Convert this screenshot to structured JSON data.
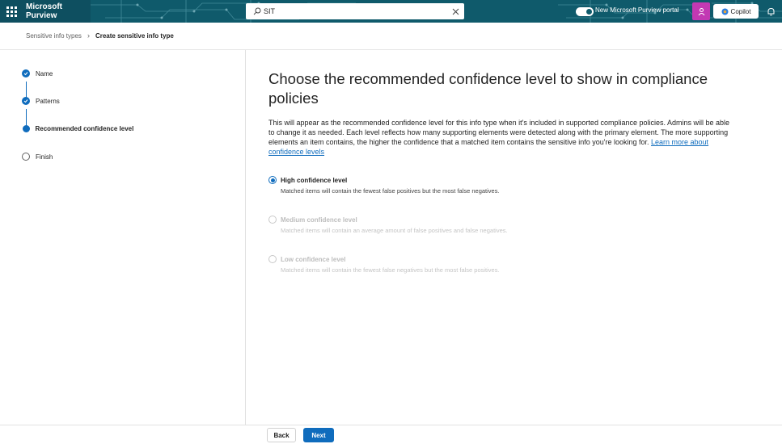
{
  "topbar": {
    "brand": "Microsoft Purview",
    "search_value": "SIT",
    "toggle_label": "New Microsoft Purview portal",
    "copilot_label": "Copilot",
    "colors": {
      "bar": "#0f5a6b",
      "accent_button": "#c239b3"
    }
  },
  "breadcrumb": {
    "items": [
      "Sensitive info types",
      "Create sensitive info type"
    ]
  },
  "wizard": {
    "steps": [
      {
        "label": "Name",
        "state": "done"
      },
      {
        "label": "Patterns",
        "state": "done"
      },
      {
        "label": "Recommended confidence level",
        "state": "current"
      },
      {
        "label": "Finish",
        "state": "pending"
      }
    ]
  },
  "main": {
    "title": "Choose the recommended confidence level to show in compliance policies",
    "description": "This will appear as the recommended confidence level for this info type when it's included in supported compliance policies. Admins will be able to change it as needed. Each level reflects how many supporting elements were detected along with the primary element. The more supporting elements an item contains, the higher the confidence that a matched item contains the sensitive info you're looking for.",
    "learn_more": "Learn more about confidence levels",
    "options": [
      {
        "label": "High confidence level",
        "description": "Matched items will contain the fewest false positives but the most false negatives.",
        "selected": true,
        "enabled": true
      },
      {
        "label": "Medium confidence level",
        "description": "Matched items will contain an average amount of false positives and false negatives.",
        "selected": false,
        "enabled": false
      },
      {
        "label": "Low confidence level",
        "description": "Matched items will contain the fewest false negatives but the most false positives.",
        "selected": false,
        "enabled": false
      }
    ]
  },
  "footer": {
    "back_label": "Back",
    "next_label": "Next"
  }
}
